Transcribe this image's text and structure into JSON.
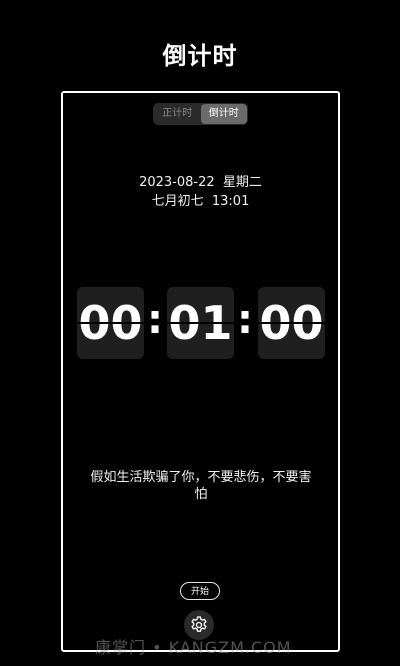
{
  "page": {
    "title": "倒计时"
  },
  "mode_toggle": {
    "tabs": [
      {
        "label": "正计时",
        "active": false
      },
      {
        "label": "倒计时",
        "active": true
      }
    ]
  },
  "date_info": {
    "gregorian": "2023-08-22  星期二",
    "lunar_time": "七月初七  13:01"
  },
  "timer": {
    "hours": "00",
    "minutes": "01",
    "seconds": "00",
    "separator": ":"
  },
  "quote": {
    "text": "假如生活欺骗了你，不要悲伤，不要害怕"
  },
  "controls": {
    "start_label": "开始",
    "settings_icon": "gear-icon"
  },
  "watermark": {
    "text": "康掌门 • KANGZM.COM"
  },
  "colors": {
    "background": "#000000",
    "card": "#1f1f1f",
    "active_tab": "#6b6b6b"
  }
}
